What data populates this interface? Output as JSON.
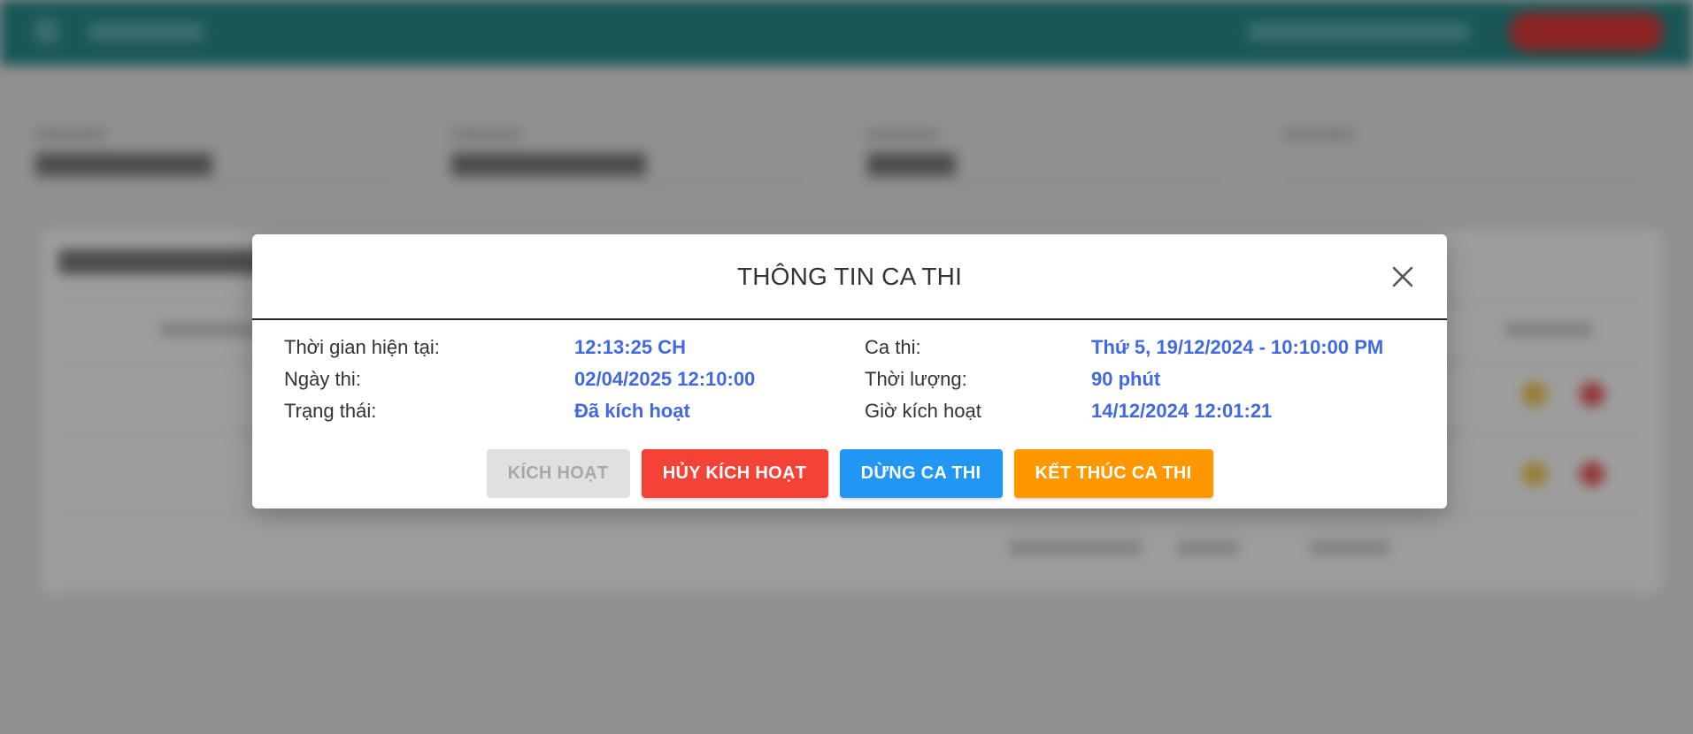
{
  "modal": {
    "title": "THÔNG TIN CA THI",
    "fields": {
      "current_time": {
        "label": "Thời gian hiện tại:",
        "value": "12:13:25 CH"
      },
      "session": {
        "label": "Ca thi:",
        "value": "Thứ 5, 19/12/2024 - 10:10:00 PM"
      },
      "exam_date": {
        "label": "Ngày thi:",
        "value": "02/04/2025 12:10:00"
      },
      "duration": {
        "label": "Thời lượng:",
        "value": "90 phút"
      },
      "status": {
        "label": "Trạng thái:",
        "value": "Đã kích hoạt"
      },
      "activation_time": {
        "label": "Giờ kích hoạt",
        "value": "14/12/2024 12:01:21"
      }
    },
    "buttons": {
      "activate": "KÍCH HOẠT",
      "deactivate": "HỦY KÍCH HOẠT",
      "pause": "DỪNG CA THI",
      "finish": "KẾT THÚC CA THI"
    }
  },
  "colors": {
    "value_text": "#4169e1",
    "deactivate": "#f44336",
    "pause": "#2196f3",
    "finish": "#ff9800",
    "disabled": "#e0e0e0",
    "topbar": "#2b8c8c"
  },
  "icons": {
    "close": "close-icon"
  }
}
